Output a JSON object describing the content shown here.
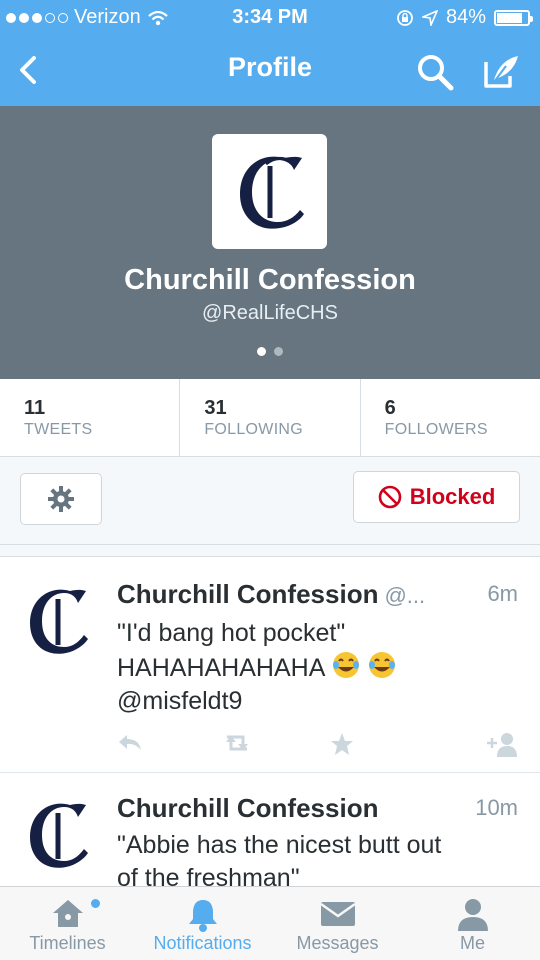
{
  "status_bar": {
    "carrier": "Verizon",
    "time": "3:34 PM",
    "battery": "84%",
    "battery_level": 0.84
  },
  "nav": {
    "title": "Profile"
  },
  "profile": {
    "name": "Churchill Confession",
    "handle": "@RealLifeCHS",
    "avatar_letter": "C"
  },
  "stats": [
    {
      "count": "11",
      "label": "TWEETS"
    },
    {
      "count": "31",
      "label": "FOLLOWING"
    },
    {
      "count": "6",
      "label": "FOLLOWERS"
    }
  ],
  "actions": {
    "blocked_label": "Blocked"
  },
  "tweets": [
    {
      "name": "Churchill Confession",
      "handle": "@...",
      "time": "6m",
      "line1": "\"I'd bang hot pocket\"",
      "line2": "HAHAHAHAHAHA",
      "line3": "@misfeldt9"
    },
    {
      "name": "Churchill Confession",
      "handle": "",
      "time": "10m",
      "line1": "\"Abbie has the nicest butt out",
      "line2": "of the freshman\""
    }
  ],
  "tabs": [
    {
      "label": "Timelines",
      "icon": "home-icon"
    },
    {
      "label": "Notifications",
      "icon": "bell-icon",
      "active": true
    },
    {
      "label": "Messages",
      "icon": "envelope-icon"
    },
    {
      "label": "Me",
      "icon": "person-icon"
    }
  ],
  "colors": {
    "brand": "#55acee",
    "header_bg": "#667580",
    "blocked": "#d0021b"
  }
}
